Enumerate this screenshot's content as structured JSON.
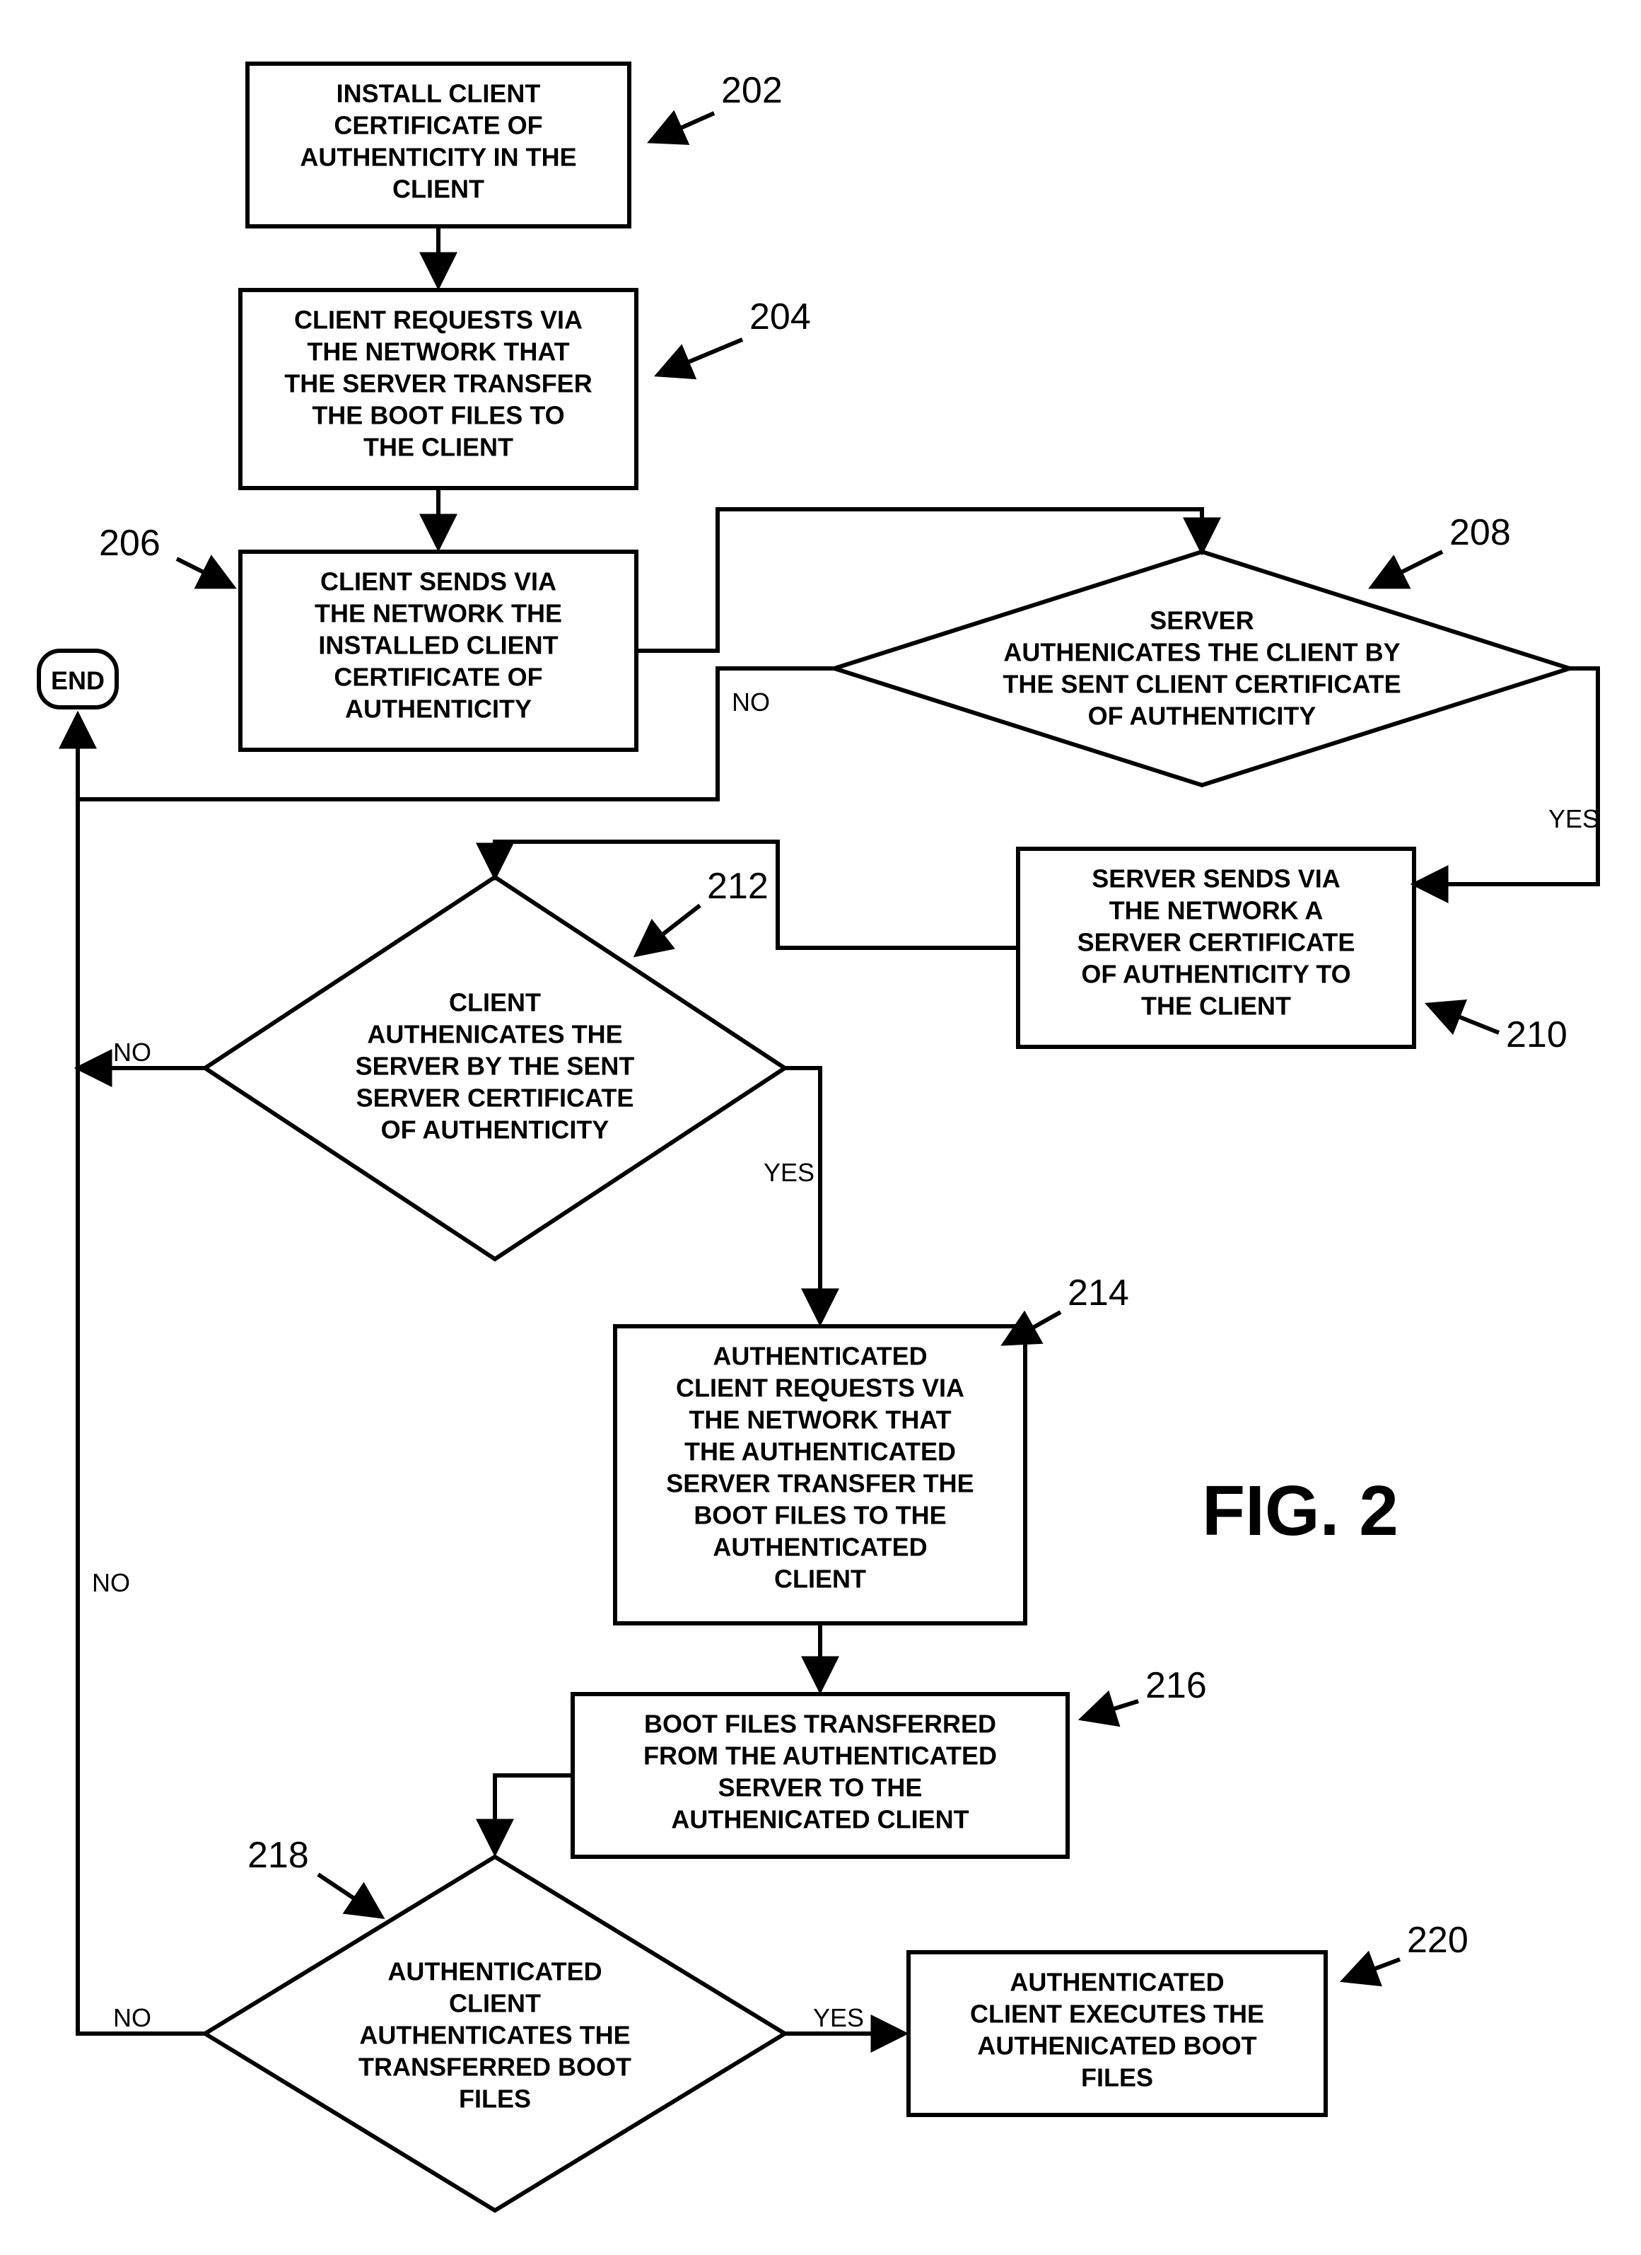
{
  "figure_label": "FIG. 2",
  "nodes": {
    "n202": {
      "ref": "202",
      "lines": [
        "INSTALL CLIENT",
        "CERTIFICATE OF",
        "AUTHENTICITY IN THE",
        "CLIENT"
      ]
    },
    "n204": {
      "ref": "204",
      "lines": [
        "CLIENT REQUESTS VIA",
        "THE NETWORK THAT",
        "THE SERVER TRANSFER",
        "THE BOOT FILES TO",
        "THE CLIENT"
      ]
    },
    "n206": {
      "ref": "206",
      "lines": [
        "CLIENT SENDS VIA",
        "THE NETWORK THE",
        "INSTALLED CLIENT",
        "CERTIFICATE OF",
        "AUTHENTICITY"
      ]
    },
    "n208": {
      "ref": "208",
      "lines": [
        "SERVER",
        "AUTHENICATES THE CLIENT BY",
        "THE SENT CLIENT CERTIFICATE",
        "OF AUTHENTICITY"
      ]
    },
    "n210": {
      "ref": "210",
      "lines": [
        "SERVER SENDS VIA",
        "THE NETWORK A",
        "SERVER CERTIFICATE",
        "OF AUTHENTICITY TO",
        "THE CLIENT"
      ]
    },
    "n212": {
      "ref": "212",
      "lines": [
        "CLIENT",
        "AUTHENICATES THE",
        "SERVER BY THE SENT",
        "SERVER CERTIFICATE",
        "OF AUTHENTICITY"
      ]
    },
    "n214": {
      "ref": "214",
      "lines": [
        "AUTHENTICATED",
        "CLIENT REQUESTS VIA",
        "THE NETWORK THAT",
        "THE AUTHENTICATED",
        "SERVER TRANSFER THE",
        "BOOT FILES TO THE",
        "AUTHENTICATED",
        "CLIENT"
      ]
    },
    "n216": {
      "ref": "216",
      "lines": [
        "BOOT FILES TRANSFERRED",
        "FROM THE AUTHENTICATED",
        "SERVER TO THE",
        "AUTHENICATED CLIENT"
      ]
    },
    "n218": {
      "ref": "218",
      "lines": [
        "AUTHENTICATED",
        "CLIENT",
        "AUTHENTICATES THE",
        "TRANSFERRED BOOT",
        "FILES"
      ]
    },
    "n220": {
      "ref": "220",
      "lines": [
        "AUTHENTICATED",
        "CLIENT EXECUTES THE",
        "AUTHENICATED BOOT",
        "FILES"
      ]
    },
    "end": {
      "lines": [
        "END"
      ]
    }
  },
  "edges": {
    "e208no": "NO",
    "e208yes": "YES",
    "e212no": "NO",
    "e212yes": "YES",
    "e218no": "NO",
    "e218yes": "YES"
  }
}
